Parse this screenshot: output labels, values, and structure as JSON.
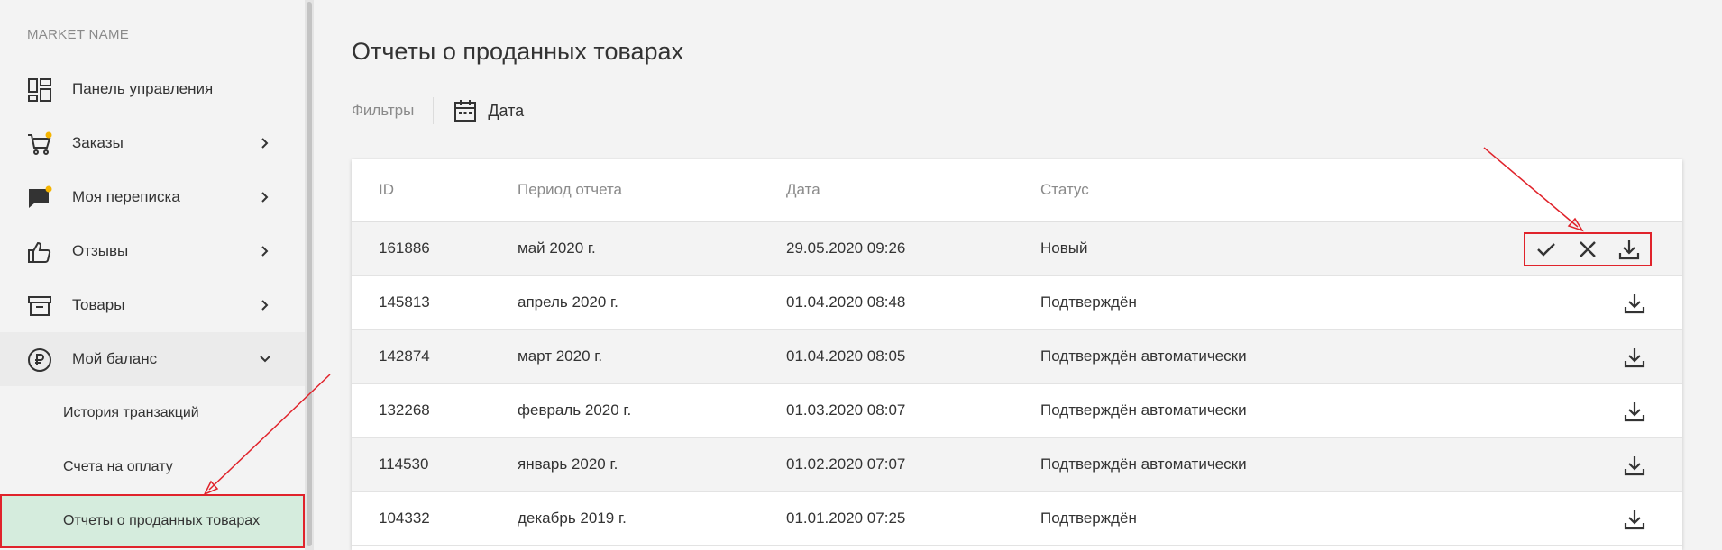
{
  "sidebar": {
    "market_name": "MARKET NAME",
    "items": [
      {
        "label": "Панель управления",
        "icon": "dashboard-icon"
      },
      {
        "label": "Заказы",
        "icon": "cart-icon",
        "badge": true
      },
      {
        "label": "Моя переписка",
        "icon": "chat-icon",
        "badge": true
      },
      {
        "label": "Отзывы",
        "icon": "thumbs-up-icon"
      },
      {
        "label": "Товары",
        "icon": "box-icon"
      },
      {
        "label": "Мой баланс",
        "icon": "balance-icon",
        "expanded": true
      }
    ],
    "sub_items": [
      {
        "label": "История транзакций"
      },
      {
        "label": "Счета на оплату"
      },
      {
        "label": "Отчеты о проданных товарах",
        "active": true
      }
    ]
  },
  "main": {
    "title": "Отчеты о проданных товарах",
    "filters_label": "Фильтры",
    "date_filter_label": "Дата"
  },
  "table": {
    "headers": {
      "id": "ID",
      "period": "Период отчета",
      "date": "Дата",
      "status": "Статус"
    },
    "rows": [
      {
        "id": "161886",
        "period": "май 2020 г.",
        "date": "29.05.2020 09:26",
        "status": "Новый",
        "actions": [
          "confirm",
          "reject",
          "download"
        ]
      },
      {
        "id": "145813",
        "period": "апрель 2020 г.",
        "date": "01.04.2020 08:48",
        "status": "Подтверждён",
        "actions": [
          "download"
        ]
      },
      {
        "id": "142874",
        "period": "март 2020 г.",
        "date": "01.04.2020 08:05",
        "status": "Подтверждён автоматически",
        "actions": [
          "download"
        ]
      },
      {
        "id": "132268",
        "period": "февраль 2020 г.",
        "date": "01.03.2020 08:07",
        "status": "Подтверждён автоматически",
        "actions": [
          "download"
        ]
      },
      {
        "id": "114530",
        "period": "январь 2020 г.",
        "date": "01.02.2020 07:07",
        "status": "Подтверждён автоматически",
        "actions": [
          "download"
        ]
      },
      {
        "id": "104332",
        "period": "декабрь 2019 г.",
        "date": "01.01.2020 07:25",
        "status": "Подтверждён",
        "actions": [
          "download"
        ]
      }
    ]
  },
  "colors": {
    "annotation": "#e0232b",
    "badge": "#f5b400",
    "active_bg": "#d5ecdd"
  }
}
